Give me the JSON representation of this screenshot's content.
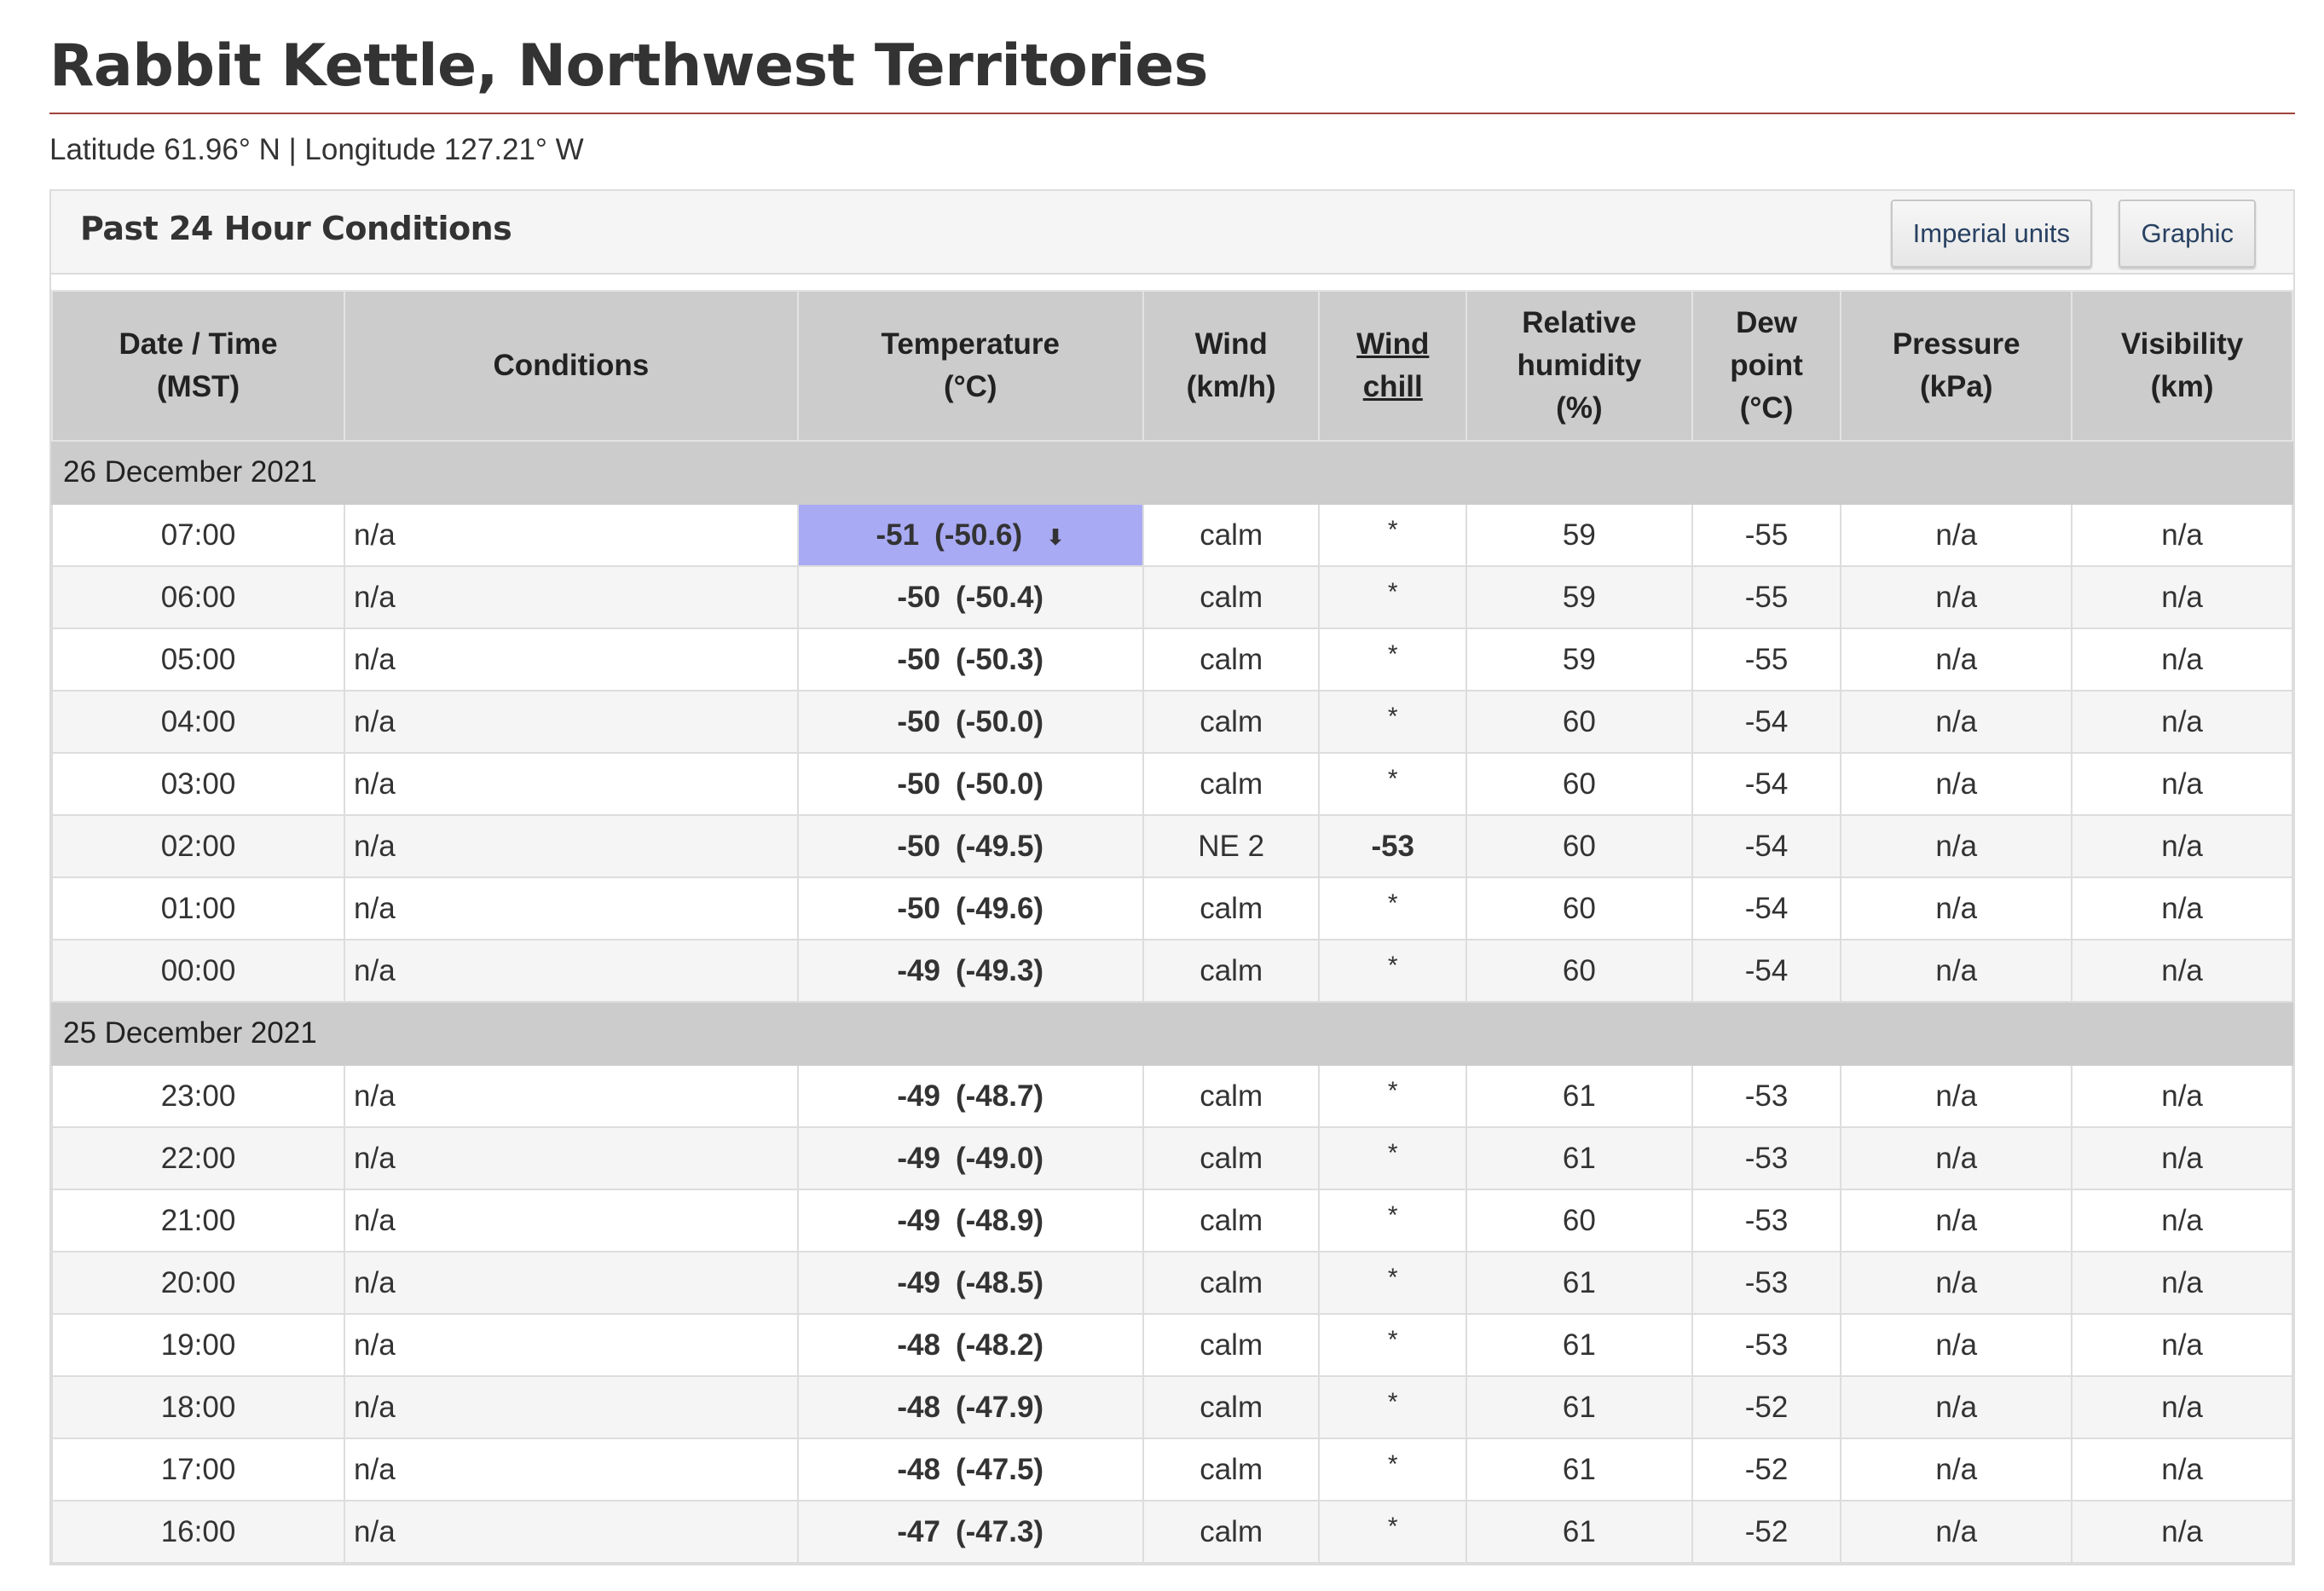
{
  "page": {
    "title": "Rabbit Kettle, Northwest Territories",
    "coords": "Latitude 61.96° N | Longitude 127.21° W"
  },
  "panel": {
    "title": "Past 24 Hour Conditions",
    "imperial_button": "Imperial units",
    "graphic_button": "Graphic"
  },
  "table": {
    "headers": {
      "datetime": [
        "Date / Time",
        "(MST)"
      ],
      "conditions": "Conditions",
      "temperature": [
        "Temperature",
        "(°C)"
      ],
      "wind": [
        "Wind",
        "(km/h)"
      ],
      "wind_chill": [
        "Wind",
        "chill"
      ],
      "humidity": [
        "Relative",
        "humidity",
        "(%)"
      ],
      "dew": [
        "Dew",
        "point",
        "(°C)"
      ],
      "pressure": [
        "Pressure",
        "(kPa)"
      ],
      "visibility": [
        "Visibility",
        "(km)"
      ]
    },
    "groups": [
      {
        "date": "26 December 2021",
        "rows": [
          {
            "time": "07:00",
            "cond": "n/a",
            "t": "-51",
            "tx": "(-50.6)",
            "wind": "calm",
            "chill": "*",
            "rh": "59",
            "dew": "-55",
            "p": "n/a",
            "vis": "n/a",
            "min": true
          },
          {
            "time": "06:00",
            "cond": "n/a",
            "t": "-50",
            "tx": "(-50.4)",
            "wind": "calm",
            "chill": "*",
            "rh": "59",
            "dew": "-55",
            "p": "n/a",
            "vis": "n/a"
          },
          {
            "time": "05:00",
            "cond": "n/a",
            "t": "-50",
            "tx": "(-50.3)",
            "wind": "calm",
            "chill": "*",
            "rh": "59",
            "dew": "-55",
            "p": "n/a",
            "vis": "n/a"
          },
          {
            "time": "04:00",
            "cond": "n/a",
            "t": "-50",
            "tx": "(-50.0)",
            "wind": "calm",
            "chill": "*",
            "rh": "60",
            "dew": "-54",
            "p": "n/a",
            "vis": "n/a"
          },
          {
            "time": "03:00",
            "cond": "n/a",
            "t": "-50",
            "tx": "(-50.0)",
            "wind": "calm",
            "chill": "*",
            "rh": "60",
            "dew": "-54",
            "p": "n/a",
            "vis": "n/a"
          },
          {
            "time": "02:00",
            "cond": "n/a",
            "t": "-50",
            "tx": "(-49.5)",
            "wind": "NE 2",
            "chill": "-53",
            "rh": "60",
            "dew": "-54",
            "p": "n/a",
            "vis": "n/a"
          },
          {
            "time": "01:00",
            "cond": "n/a",
            "t": "-50",
            "tx": "(-49.6)",
            "wind": "calm",
            "chill": "*",
            "rh": "60",
            "dew": "-54",
            "p": "n/a",
            "vis": "n/a"
          },
          {
            "time": "00:00",
            "cond": "n/a",
            "t": "-49",
            "tx": "(-49.3)",
            "wind": "calm",
            "chill": "*",
            "rh": "60",
            "dew": "-54",
            "p": "n/a",
            "vis": "n/a"
          }
        ]
      },
      {
        "date": "25 December 2021",
        "rows": [
          {
            "time": "23:00",
            "cond": "n/a",
            "t": "-49",
            "tx": "(-48.7)",
            "wind": "calm",
            "chill": "*",
            "rh": "61",
            "dew": "-53",
            "p": "n/a",
            "vis": "n/a"
          },
          {
            "time": "22:00",
            "cond": "n/a",
            "t": "-49",
            "tx": "(-49.0)",
            "wind": "calm",
            "chill": "*",
            "rh": "61",
            "dew": "-53",
            "p": "n/a",
            "vis": "n/a"
          },
          {
            "time": "21:00",
            "cond": "n/a",
            "t": "-49",
            "tx": "(-48.9)",
            "wind": "calm",
            "chill": "*",
            "rh": "60",
            "dew": "-53",
            "p": "n/a",
            "vis": "n/a"
          },
          {
            "time": "20:00",
            "cond": "n/a",
            "t": "-49",
            "tx": "(-48.5)",
            "wind": "calm",
            "chill": "*",
            "rh": "61",
            "dew": "-53",
            "p": "n/a",
            "vis": "n/a"
          },
          {
            "time": "19:00",
            "cond": "n/a",
            "t": "-48",
            "tx": "(-48.2)",
            "wind": "calm",
            "chill": "*",
            "rh": "61",
            "dew": "-53",
            "p": "n/a",
            "vis": "n/a"
          },
          {
            "time": "18:00",
            "cond": "n/a",
            "t": "-48",
            "tx": "(-47.9)",
            "wind": "calm",
            "chill": "*",
            "rh": "61",
            "dew": "-52",
            "p": "n/a",
            "vis": "n/a"
          },
          {
            "time": "17:00",
            "cond": "n/a",
            "t": "-48",
            "tx": "(-47.5)",
            "wind": "calm",
            "chill": "*",
            "rh": "61",
            "dew": "-52",
            "p": "n/a",
            "vis": "n/a"
          },
          {
            "time": "16:00",
            "cond": "n/a",
            "t": "-47",
            "tx": "(-47.3)",
            "wind": "calm",
            "chill": "*",
            "rh": "61",
            "dew": "-52",
            "p": "n/a",
            "vis": "n/a"
          }
        ]
      }
    ]
  },
  "icons": {
    "min_marker": "arrow-down-icon"
  },
  "colors": {
    "accent_rule": "#a0433b",
    "min_highlight": "#a9aaf4",
    "header_bg": "#cccccc"
  }
}
